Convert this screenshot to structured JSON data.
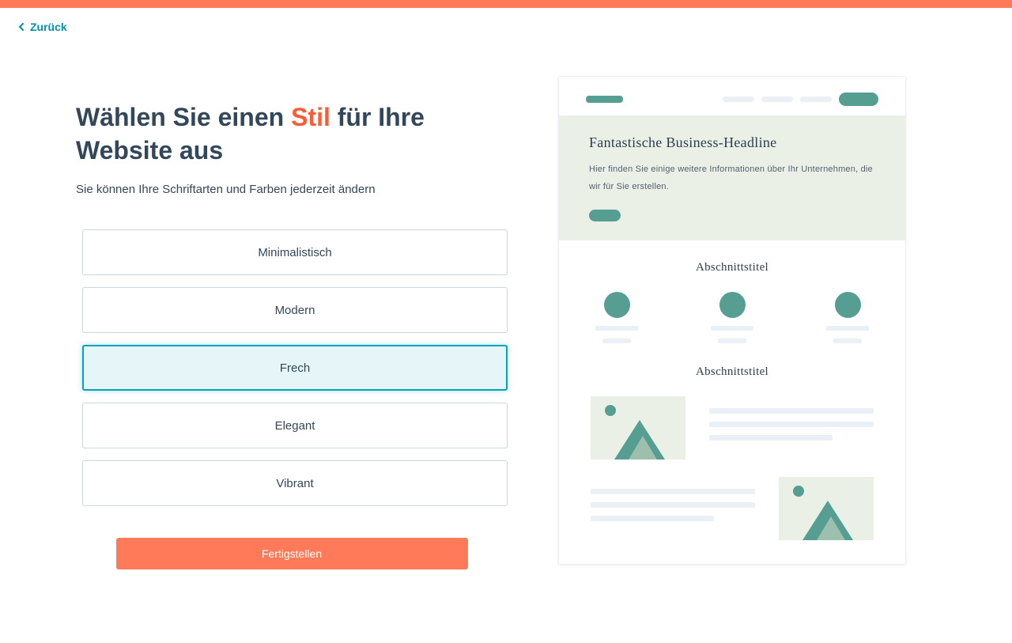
{
  "nav": {
    "back": "Zurück"
  },
  "heading": {
    "part1": "Wählen Sie einen ",
    "accent": "Stil",
    "part2": " für Ihre Website aus"
  },
  "subtitle": "Sie können Ihre Schriftarten und Farben jederzeit ändern",
  "options": [
    {
      "label": "Minimalistisch",
      "selected": false
    },
    {
      "label": "Modern",
      "selected": false
    },
    {
      "label": "Frech",
      "selected": true
    },
    {
      "label": "Elegant",
      "selected": false
    },
    {
      "label": "Vibrant",
      "selected": false
    }
  ],
  "cta": "Fertigstellen",
  "preview": {
    "hero_title": "Fantastische Business-Headline",
    "hero_text": "Hier finden Sie einige weitere Informationen über Ihr Unternehmen, die wir für Sie erstellen.",
    "section1_title": "Abschnittstitel",
    "section2_title": "Abschnittstitel"
  }
}
